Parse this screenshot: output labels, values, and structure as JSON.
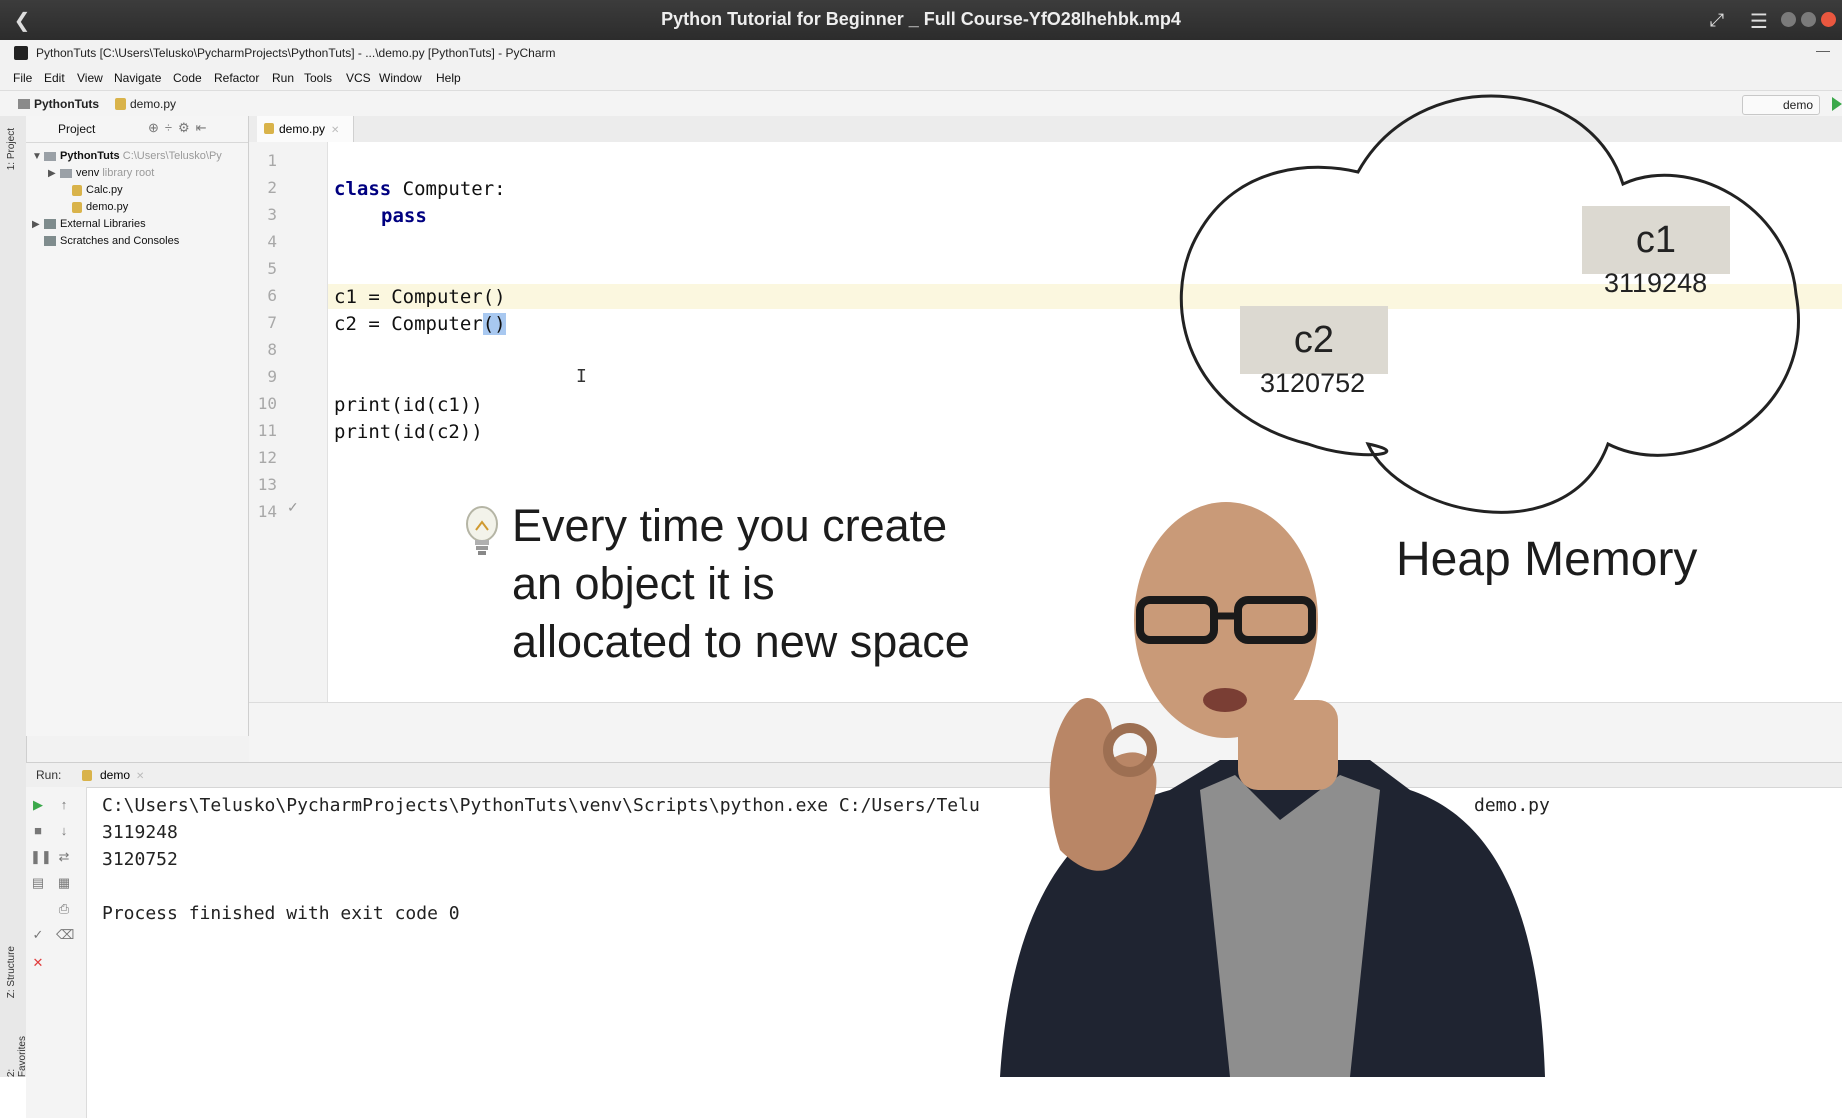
{
  "player": {
    "title": "Python Tutorial for Beginner _ Full Course-YfO28Ihehbk.mp4"
  },
  "ide": {
    "window_title": "PythonTuts [C:\\Users\\Telusko\\PycharmProjects\\PythonTuts] - ...\\demo.py [PythonTuts] - PyCharm",
    "menu": [
      "File",
      "Edit",
      "View",
      "Navigate",
      "Code",
      "Refactor",
      "Run",
      "Tools",
      "VCS",
      "Window",
      "Help"
    ],
    "breadcrumb": [
      "PythonTuts",
      "demo.py"
    ],
    "run_config": "demo",
    "side_tabs": [
      "1: Project",
      "Z: Structure",
      "2: Favorites"
    ]
  },
  "project": {
    "header": "Project",
    "tree": [
      {
        "label": "PythonTuts",
        "hint": "C:\\Users\\Telusko\\Py"
      },
      {
        "label": "venv",
        "hint": "library root"
      },
      {
        "label": "Calc.py",
        "hint": ""
      },
      {
        "label": "demo.py",
        "hint": ""
      },
      {
        "label": "External Libraries",
        "hint": ""
      },
      {
        "label": "Scratches and Consoles",
        "hint": ""
      }
    ]
  },
  "editor": {
    "tab": "demo.py",
    "line_numbers": [
      "1",
      "2",
      "3",
      "4",
      "5",
      "6",
      "7",
      "8",
      "9",
      "10",
      "11",
      "12",
      "13",
      "14"
    ],
    "code": {
      "l2_kw": "class",
      "l2_rest": " Computer:",
      "l3_kw": "pass",
      "l6": "c1 = Computer()",
      "l7_a": "c2 = Computer",
      "l7_sel": "()",
      "l10": "print(id(c1))",
      "l11": "print(id(c2))"
    }
  },
  "run": {
    "label": "Run:",
    "tab": "demo",
    "console": [
      "C:\\Users\\Telusko\\PycharmProjects\\PythonTuts\\venv\\Scripts\\python.exe C:/Users/Telu",
      "3119248",
      "3120752",
      "",
      "Process finished with exit code 0"
    ],
    "console_tail": "demo.py"
  },
  "overlay": {
    "caption": [
      "Every time you create",
      "an object it is",
      "allocated to new space"
    ],
    "heap_label": "Heap Memory",
    "objects": [
      {
        "name": "c1",
        "address": "3119248"
      },
      {
        "name": "c2",
        "address": "3120752"
      }
    ]
  },
  "colors": {
    "keyword": "#000080",
    "selection": "#a8c8f0",
    "current_line": "#fbf7df",
    "run_green": "#3aa84a",
    "stop_red": "#e03c3c"
  }
}
